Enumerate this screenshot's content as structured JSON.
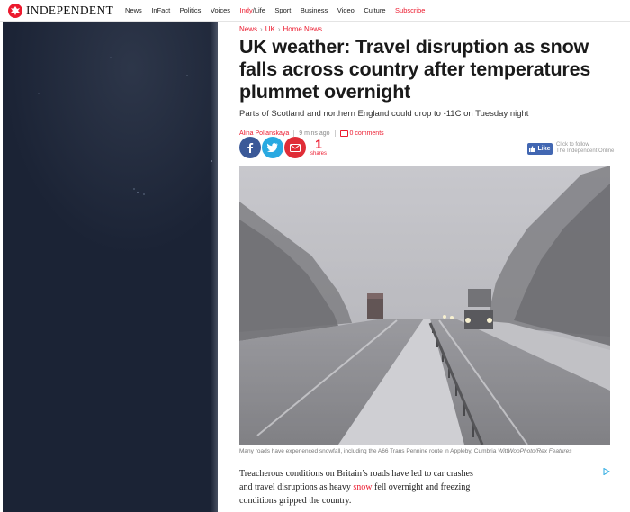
{
  "brand": {
    "logo_text": "INDEPENDENT",
    "accent": "#ec1a2e"
  },
  "nav": {
    "items": [
      {
        "label": "News"
      },
      {
        "label": "InFact"
      },
      {
        "label": "Politics"
      },
      {
        "label": "Voices"
      },
      {
        "label_a": "Indy",
        "label_sep": "/",
        "label_b": "Life"
      },
      {
        "label": "Sport"
      },
      {
        "label": "Business"
      },
      {
        "label": "Video"
      },
      {
        "label": "Culture"
      },
      {
        "label": "Subscribe"
      }
    ]
  },
  "article": {
    "breadcrumb": [
      "News",
      "UK",
      "Home News"
    ],
    "breadcrumb_sep": "›",
    "headline": "UK weather: Travel disruption as snow falls across country after temperatures plummet overnight",
    "standfirst": "Parts of Scotland and northern England could drop to -11C on Tuesday night",
    "author": "Alina Polianskaya",
    "time": "9 mins ago",
    "comments": "0  comments",
    "share_count": "1",
    "share_label": "shares",
    "caption": "Many roads have experienced snowfall, including the A66 Trans Pennine route in Appleby, Cumbria",
    "caption_credit": "WittWooPhoto/Rex Features",
    "body_a": "Treacherous conditions on Britain’s roads have led to car crashes and travel disruptions as heavy ",
    "body_link": "snow",
    "body_b": " fell overnight and freezing conditions gripped the country."
  },
  "social": {
    "fb_color": "#3b5998",
    "tw_color": "#29a9e1",
    "email_color": "#e02d37",
    "like_label": "Like",
    "follow_line1": "Click to follow",
    "follow_line2": "The Independent Online"
  }
}
